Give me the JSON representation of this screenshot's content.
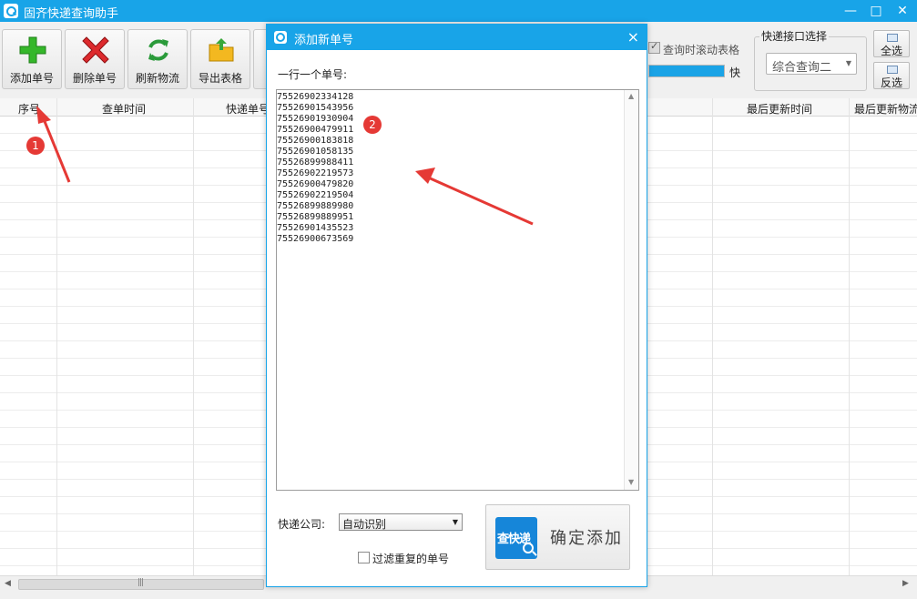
{
  "app": {
    "title": "固齐快递查询助手",
    "icon": "app-logo-icon",
    "controls": {
      "minimize": "—",
      "maximize": "□",
      "close": "✕"
    }
  },
  "toolbar": {
    "buttons": [
      {
        "label": "添加单号",
        "icon": "plus-icon",
        "color": "#2ea820"
      },
      {
        "label": "删除单号",
        "icon": "delete-x-icon",
        "color": "#d6282b"
      },
      {
        "label": "刷新物流",
        "icon": "refresh-icon",
        "color": "#2a9a3a"
      },
      {
        "label": "导出表格",
        "icon": "folder-export-icon",
        "color": "#f0b400"
      }
    ],
    "scroll_checkbox": {
      "label": "查询时滚动表格",
      "checked": true
    },
    "speed_label": "快",
    "speed_level": 1.0,
    "api_group": {
      "label": "快递接口选择",
      "selected": "综合查询二"
    },
    "select_all": "全选",
    "invert_select": "反选"
  },
  "grid": {
    "columns": [
      "序号",
      "查单时间",
      "快递单号",
      "最后更新时间",
      "最后更新物流"
    ]
  },
  "annotations": {
    "marker_1": "1",
    "marker_2": "2",
    "color": "#e53935"
  },
  "dialog": {
    "title": "添加新单号",
    "close": "×",
    "prompt": "一行一个单号:",
    "tracking_numbers": [
      "75526902334128",
      "75526901543956",
      "75526901930904",
      "75526900479911",
      "75526900183818",
      "75526901058135",
      "75526899988411",
      "75526902219573",
      "75526900479820",
      "75526902219504",
      "75526899889980",
      "75526899889951",
      "75526901435523",
      "75526900673569"
    ],
    "company_label": "快递公司:",
    "company_selected": "自动识别",
    "filter_label": "过滤重复的单号",
    "filter_checked": false,
    "logo_text": "查快递",
    "confirm_label": "确定添加",
    "accent": "#18a4e8"
  }
}
